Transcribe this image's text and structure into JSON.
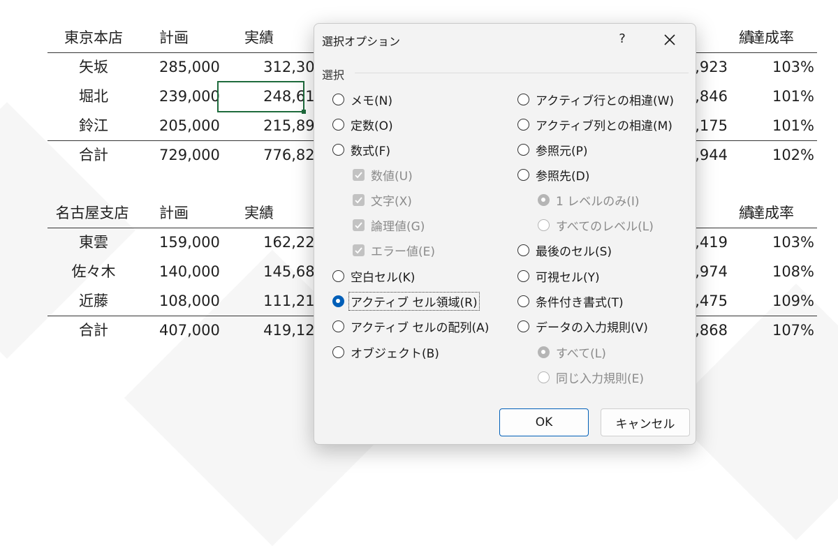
{
  "sheet": {
    "tokyo": {
      "header": [
        "東京本店",
        "計画",
        "実績",
        "績",
        "達成率"
      ],
      "rows": [
        [
          "矢坂",
          "285,000",
          "312,304",
          ",923",
          "103%"
        ],
        [
          "堀北",
          "239,000",
          "248,619",
          ",846",
          "101%"
        ],
        [
          "鈴江",
          "205,000",
          "215,898",
          ",175",
          "101%"
        ]
      ],
      "total": [
        "合計",
        "729,000",
        "776,821",
        ",944",
        "102%"
      ]
    },
    "nagoya": {
      "header": [
        "名古屋支店",
        "計画",
        "実績",
        "績",
        "達成率"
      ],
      "rows": [
        [
          "東雲",
          "159,000",
          "162,223",
          ",419",
          "103%"
        ],
        [
          "佐々木",
          "140,000",
          "145,687",
          ",974",
          "108%"
        ],
        [
          "近藤",
          "108,000",
          "111,216",
          ",475",
          "109%"
        ]
      ],
      "total": [
        "合計",
        "407,000",
        "419,126",
        ",868",
        "107%"
      ]
    }
  },
  "dialog": {
    "title": "選択オプション",
    "help": "?",
    "group_label": "選択",
    "left_options": [
      {
        "label": "メモ(N)",
        "state": "unchecked"
      },
      {
        "label": "定数(O)",
        "state": "unchecked"
      },
      {
        "label": "数式(F)",
        "state": "unchecked"
      },
      {
        "label": "数値(U)",
        "state": "disabled-checkbox"
      },
      {
        "label": "文字(X)",
        "state": "disabled-checkbox"
      },
      {
        "label": "論理値(G)",
        "state": "disabled-checkbox"
      },
      {
        "label": "エラー値(E)",
        "state": "disabled-checkbox"
      },
      {
        "label": "空白セル(K)",
        "state": "unchecked"
      },
      {
        "label": "アクティブ セル領域(R)",
        "state": "checked"
      },
      {
        "label": "アクティブ セルの配列(A)",
        "state": "unchecked"
      },
      {
        "label": "オブジェクト(B)",
        "state": "unchecked"
      }
    ],
    "right_options": [
      {
        "label": "アクティブ行との相違(W)",
        "state": "unchecked"
      },
      {
        "label": "アクティブ列との相違(M)",
        "state": "unchecked"
      },
      {
        "label": "参照元(P)",
        "state": "unchecked"
      },
      {
        "label": "参照先(D)",
        "state": "unchecked"
      },
      {
        "label": "1 レベルのみ(I)",
        "state": "disabled-checked"
      },
      {
        "label": "すべてのレベル(L)",
        "state": "disabled"
      },
      {
        "label": "最後のセル(S)",
        "state": "unchecked"
      },
      {
        "label": "可視セル(Y)",
        "state": "unchecked"
      },
      {
        "label": "条件付き書式(T)",
        "state": "unchecked"
      },
      {
        "label": "データの入力規則(V)",
        "state": "unchecked"
      },
      {
        "label": "すべて(L)",
        "state": "disabled-checked"
      },
      {
        "label": "同じ入力規則(E)",
        "state": "disabled"
      }
    ],
    "ok_label": "OK",
    "cancel_label": "キャンセル",
    "accent_color": "#005fb8"
  }
}
